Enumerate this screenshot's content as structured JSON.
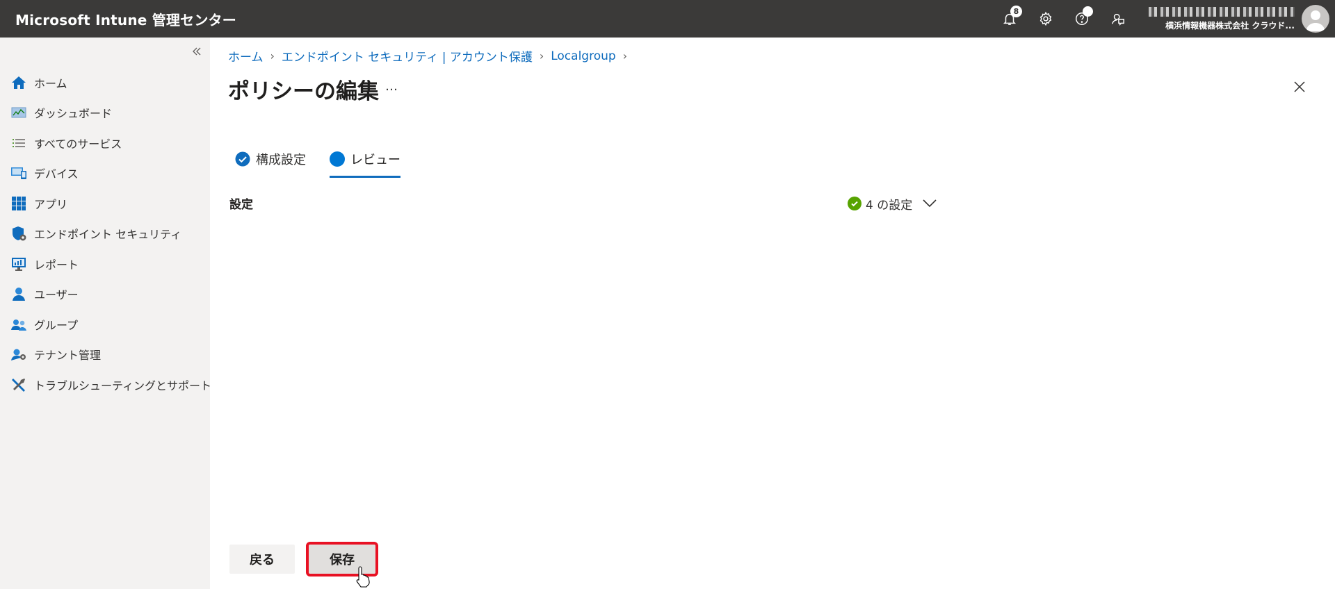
{
  "app": {
    "title": "Microsoft Intune 管理センター"
  },
  "header": {
    "notifications": {
      "count": "8",
      "icon": "bell-icon"
    },
    "settings_icon": "gear-icon",
    "help_icon": "help-icon",
    "feedback_icon": "feedback-icon",
    "account": {
      "tenant": "横浜情報機器株式会社 クラウド..."
    }
  },
  "sidebar": {
    "collapse_icon": "double-chevron-left-icon",
    "items": [
      {
        "label": "ホーム",
        "icon": "home-icon"
      },
      {
        "label": "ダッシュボード",
        "icon": "dashboard-icon"
      },
      {
        "label": "すべてのサービス",
        "icon": "list-icon"
      },
      {
        "label": "デバイス",
        "icon": "device-icon"
      },
      {
        "label": "アプリ",
        "icon": "apps-grid-icon"
      },
      {
        "label": "エンドポイント セキュリティ",
        "icon": "shield-icon"
      },
      {
        "label": "レポート",
        "icon": "report-icon"
      },
      {
        "label": "ユーザー",
        "icon": "user-icon"
      },
      {
        "label": "グループ",
        "icon": "group-icon"
      },
      {
        "label": "テナント管理",
        "icon": "tenant-admin-icon"
      },
      {
        "label": "トラブルシューティングとサポート",
        "icon": "tools-icon"
      }
    ]
  },
  "breadcrumb": [
    "ホーム",
    "エンドポイント セキュリティ | アカウント保護",
    "Localgroup"
  ],
  "page": {
    "title": "ポリシーの編集",
    "more": "…"
  },
  "tabs": [
    {
      "label": "構成設定",
      "state": "completed"
    },
    {
      "label": "レビュー",
      "state": "active"
    }
  ],
  "section": {
    "label": "設定",
    "status": "4 の設定"
  },
  "footer": {
    "back_label": "戻る",
    "save_label": "保存"
  },
  "colors": {
    "accent": "#0f6cbd",
    "success": "#57a300",
    "highlight": "#e81123",
    "topbar": "#3b3a39"
  }
}
